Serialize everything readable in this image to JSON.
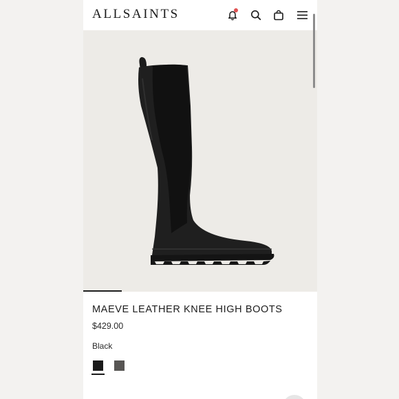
{
  "brand": {
    "logo": "ALLSAINTS"
  },
  "header": {
    "icons": [
      "notification-bell-icon",
      "search-icon",
      "shopping-bag-icon",
      "hamburger-menu-icon"
    ],
    "notification_dot_color": "#e05252"
  },
  "product": {
    "name": "MAEVE LEATHER KNEE HIGH BOOTS",
    "price": "$429.00",
    "selected_color": "Black",
    "swatches": [
      {
        "color": "#1a1a1a",
        "selected": true
      },
      {
        "color": "#575553",
        "selected": false
      }
    ]
  },
  "colors": {
    "image_background": "#edebe7",
    "page_background": "#f3f2f0"
  }
}
